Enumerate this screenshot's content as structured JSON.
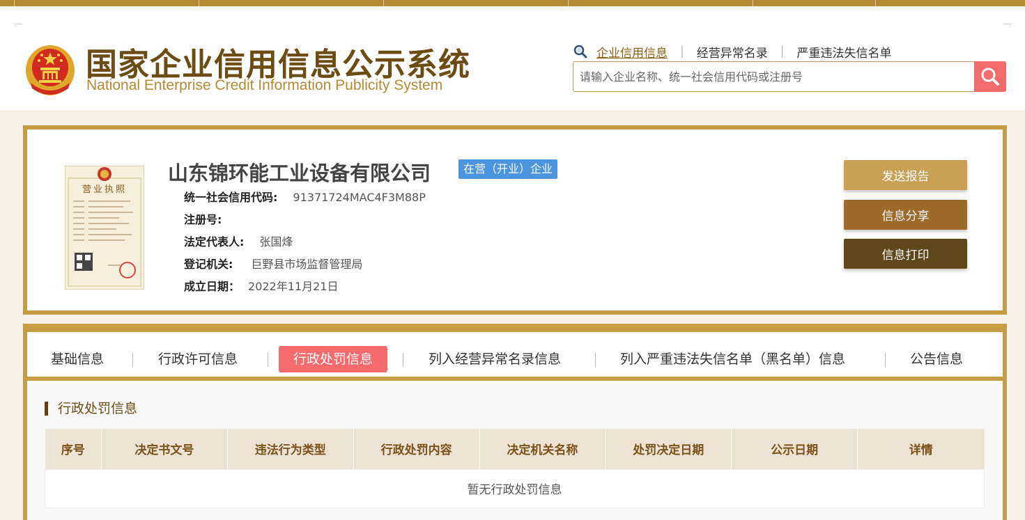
{
  "header": {
    "logo_cn": "国家企业信用信息公示系统",
    "logo_en": "National Enterprise Credit Information Publicity System",
    "search_links": [
      "企业信用信息",
      "经营异常名录",
      "严重违法失信名单"
    ],
    "search_placeholder": "请输入企业名称、统一社会信用代码或注册号"
  },
  "company": {
    "name": "山东锦环能工业设备有限公司",
    "status": "在营（开业）企业",
    "license_title": "营业执照",
    "fields": [
      {
        "label": "统一社会信用代码:",
        "value": "91371724MAC4F3M88P"
      },
      {
        "label": "注册号:",
        "value": ""
      },
      {
        "label": "法定代表人:",
        "value": "张国烽"
      },
      {
        "label": "登记机关:",
        "value": "巨野县市场监督管理局"
      },
      {
        "label": "成立日期：",
        "value": "2022年11月21日"
      }
    ]
  },
  "actions": {
    "send_report": "发送报告",
    "share": "信息分享",
    "print": "信息打印"
  },
  "tabs": [
    "基础信息",
    "行政许可信息",
    "行政处罚信息",
    "列入经营异常名录信息",
    "列入严重违法失信名单（黑名单）信息",
    "公告信息"
  ],
  "penalty": {
    "title": "行政处罚信息",
    "columns": [
      "序号",
      "决定书文号",
      "违法行为类型",
      "行政处罚内容",
      "决定机关名称",
      "处罚决定日期",
      "公示日期",
      "详情"
    ],
    "empty_text": "暂无行政处罚信息"
  },
  "colors": {
    "gold": "#c89c42",
    "brown": "#6b4c13",
    "active_tab": "#f56a6a",
    "status_badge": "#4a94e0",
    "btn_send": "#c9a056",
    "btn_share": "#9d6a2a",
    "btn_print": "#5e4719"
  }
}
